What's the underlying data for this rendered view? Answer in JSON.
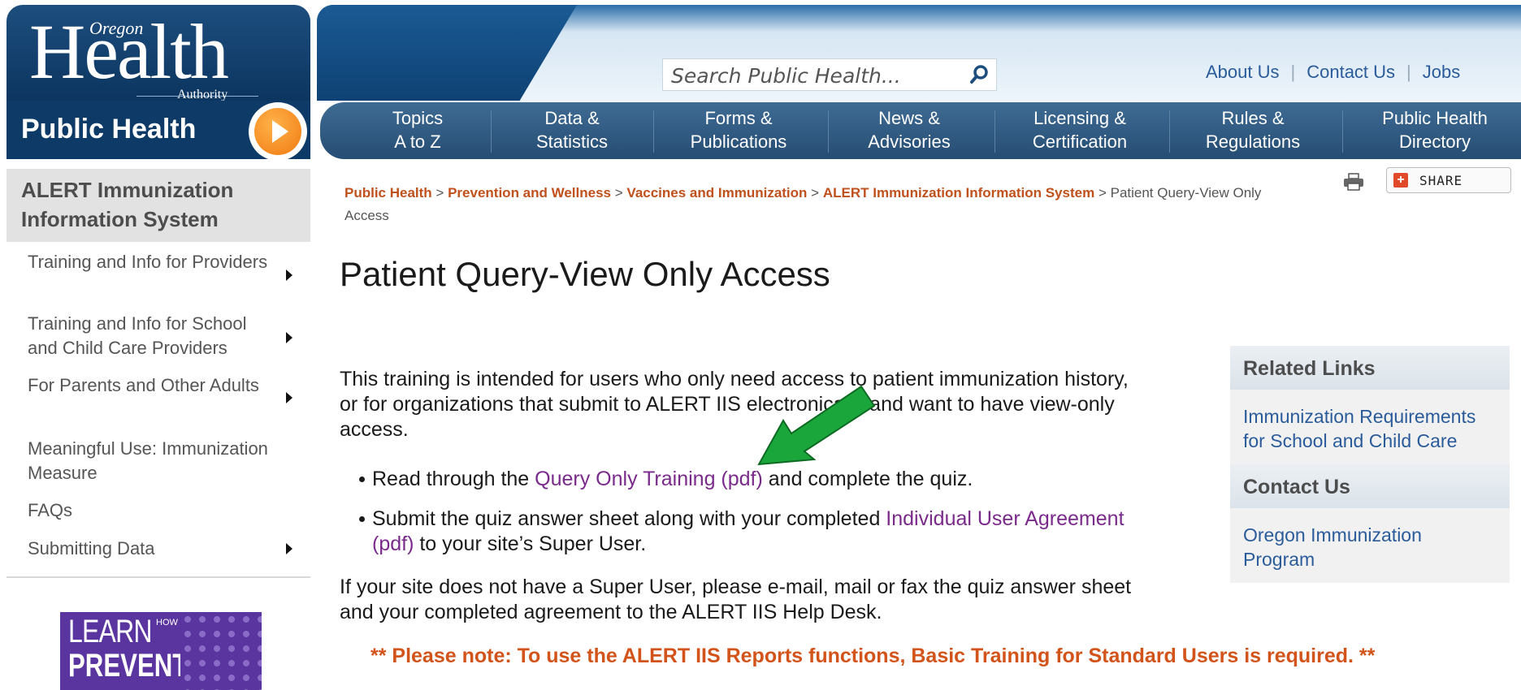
{
  "header": {
    "logo": {
      "oregon": "Oregon",
      "health": "Health",
      "authority": "Authority"
    },
    "section_title": "Public Health",
    "search": {
      "placeholder": "Search Public Health..."
    },
    "utility_links": [
      "About Us",
      "Contact Us",
      "Jobs"
    ],
    "nav": [
      {
        "line1": "Topics",
        "line2": "A to Z"
      },
      {
        "line1": "Data &",
        "line2": "Statistics"
      },
      {
        "line1": "Forms &",
        "line2": "Publications"
      },
      {
        "line1": "News &",
        "line2": "Advisories"
      },
      {
        "line1": "Licensing &",
        "line2": "Certification"
      },
      {
        "line1": "Rules &",
        "line2": "Regulations"
      },
      {
        "line1": "Public Health",
        "line2": "Directory"
      }
    ]
  },
  "sidebar": {
    "heading": "ALERT Immunization Information System",
    "items": [
      {
        "label": "Training and Info for Providers",
        "has_arrow": true
      },
      {
        "label": "Training and Info for School and Child Care Providers",
        "has_arrow": true
      },
      {
        "label": "For Parents and Other Adults",
        "has_arrow": true
      },
      {
        "label": "Meaningful Use: Immunization Measure",
        "has_arrow": false
      },
      {
        "label": "FAQs",
        "has_arrow": false
      },
      {
        "label": "Submitting Data",
        "has_arrow": true
      }
    ],
    "ad": {
      "learn": "LEARN",
      "how_to": "HOW TO",
      "prevent": "PREVENT"
    }
  },
  "breadcrumb": {
    "links": [
      "Public Health",
      "Prevention and Wellness",
      "Vaccines and Immunization",
      "ALERT Immunization Information System"
    ],
    "separator": ">",
    "current": "Patient Query-View Only Access"
  },
  "tools": {
    "share_label": "SHARE",
    "print_icon": "printer-icon"
  },
  "main": {
    "title": "Patient Query-View Only Access",
    "intro_line1": "This training is intended for users who only need access to patient immunization history,",
    "intro_line2": "or for organizations that submit to ALERT IIS electronically and want to have view-only",
    "intro_line3": "access.",
    "bullet1_pre": "Read through the ",
    "bullet1_link": "Query Only Training (pdf)",
    "bullet1_post": " and complete the quiz.",
    "bullet2_pre": "Submit the quiz answer sheet along with your completed ",
    "bullet2_link_a": "Individual User Agreement",
    "bullet2_link_b": "(pdf)",
    "bullet2_post": " to your site’s Super User.",
    "para2_line1": "If your site does not have a Super User, please e-mail, mail or fax the quiz answer sheet",
    "para2_line2": "and your completed agreement to the ALERT IIS Help Desk.",
    "note": "** Please note: To use the ALERT IIS Reports functions, Basic Training for Standard Users is required. **"
  },
  "related": {
    "heading": "Related Links",
    "link1_a": "Immunization Requirements",
    "link1_b": "for School and Child Care",
    "contact_heading": "Contact Us",
    "link2_a": "Oregon Immunization",
    "link2_b": "Program"
  },
  "colors": {
    "brand_blue": "#0d3a66",
    "link_orange": "#c0501c",
    "visited_purple": "#7a2a8a",
    "arrow_green": "#1aa63a"
  }
}
